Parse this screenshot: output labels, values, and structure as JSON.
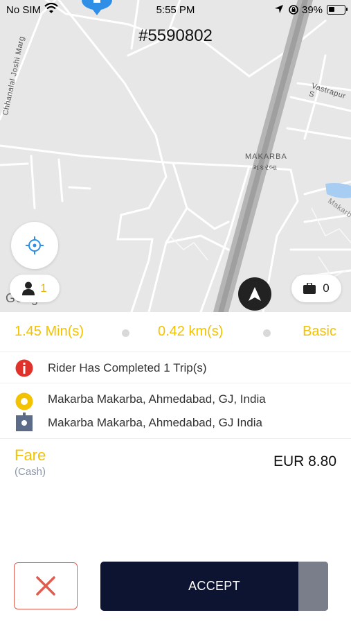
{
  "status_bar": {
    "carrier": "No SIM",
    "time": "5:55 PM",
    "battery_percent": "39%",
    "battery_level": 0.39
  },
  "map": {
    "trip_id": "#5590802",
    "labels": {
      "road_left": "Chhanalal Joshi Marg",
      "road_top_right": "Vastrapur S",
      "area_name": "MAKARBA",
      "area_name_local": "મકરબા",
      "road_right": "Makarb"
    },
    "rider_count": "1",
    "bag_count": "0",
    "google_logo": "Goog"
  },
  "trip_stats": {
    "duration": "1.45 Min(s)",
    "distance": "0.42 km(s)",
    "vehicle_type": "Basic"
  },
  "rider_info": {
    "text": "Rider Has Completed 1 Trip(s)"
  },
  "route": {
    "pickup": "Makarba Makarba, Ahmedabad, GJ, India",
    "dropoff": "Makarba Makarba, Ahmedabad, GJ India"
  },
  "fare": {
    "label": "Fare",
    "payment_method": "(Cash)",
    "amount": "EUR 8.80"
  },
  "actions": {
    "accept_label": "ACCEPT",
    "accept_progress": 0.13
  },
  "colors": {
    "accent_yellow": "#f3c200",
    "accept_bg": "#0c1431",
    "decline_red": "#e25b4f",
    "info_red": "#e0322a",
    "locate_blue": "#2f8fe6"
  },
  "icons": {
    "wifi": "wifi-icon",
    "location": "location-arrow-icon",
    "lock": "rotation-lock-icon",
    "pin": "map-pin-icon",
    "locate": "crosshair-icon",
    "rider": "person-icon",
    "navigate": "navigation-arrow-icon",
    "bag": "briefcase-icon",
    "info": "info-icon",
    "pickup": "pickup-marker-icon",
    "dropoff": "dropoff-marker-icon",
    "decline": "close-icon"
  }
}
